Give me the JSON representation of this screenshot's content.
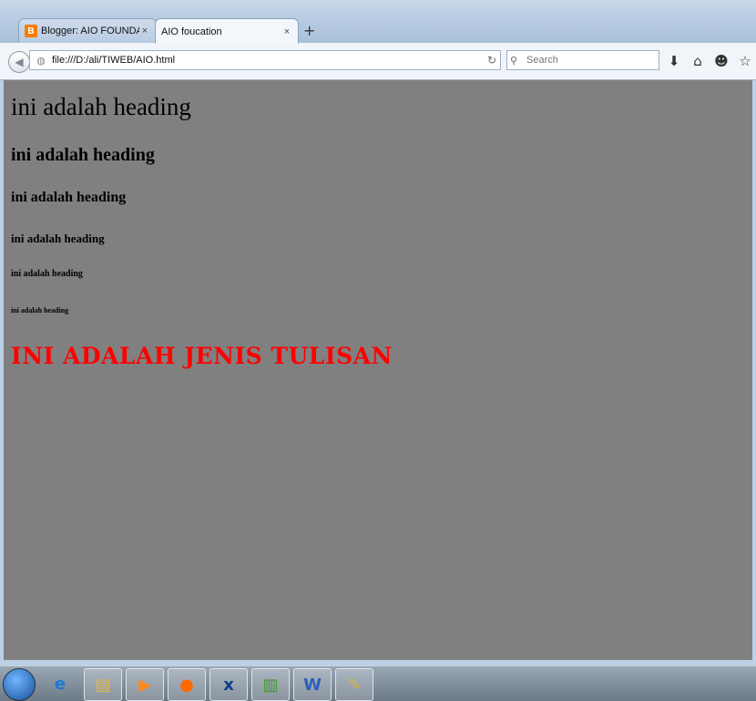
{
  "browser": {
    "tabs": [
      {
        "label": "Blogger: AIO FOUNDATIO...",
        "close": "×",
        "favicon": "B"
      },
      {
        "label": "AIO foucation",
        "close": "×"
      }
    ],
    "new_tab": "+",
    "url": "file:///D:/ali/TIWEB/AIO.html",
    "search_placeholder": "Search"
  },
  "page": {
    "headings": [
      "ini adalah heading",
      "ini adalah heading",
      "ini adalah heading",
      "ini adalah heading",
      "ini adalah heading",
      "ini adalah heading"
    ],
    "special_text": "INI ADALAH JENIS TULISAN",
    "special_color": "#ff0000",
    "background_color": "#808080"
  },
  "taskbar": {
    "items": [
      "start-orb-icon",
      "internet-explorer-icon",
      "file-explorer-icon",
      "media-player-icon",
      "firefox-icon",
      "xl-app-icon",
      "notepad-plus-icon",
      "word-icon",
      "paint-icon"
    ]
  }
}
